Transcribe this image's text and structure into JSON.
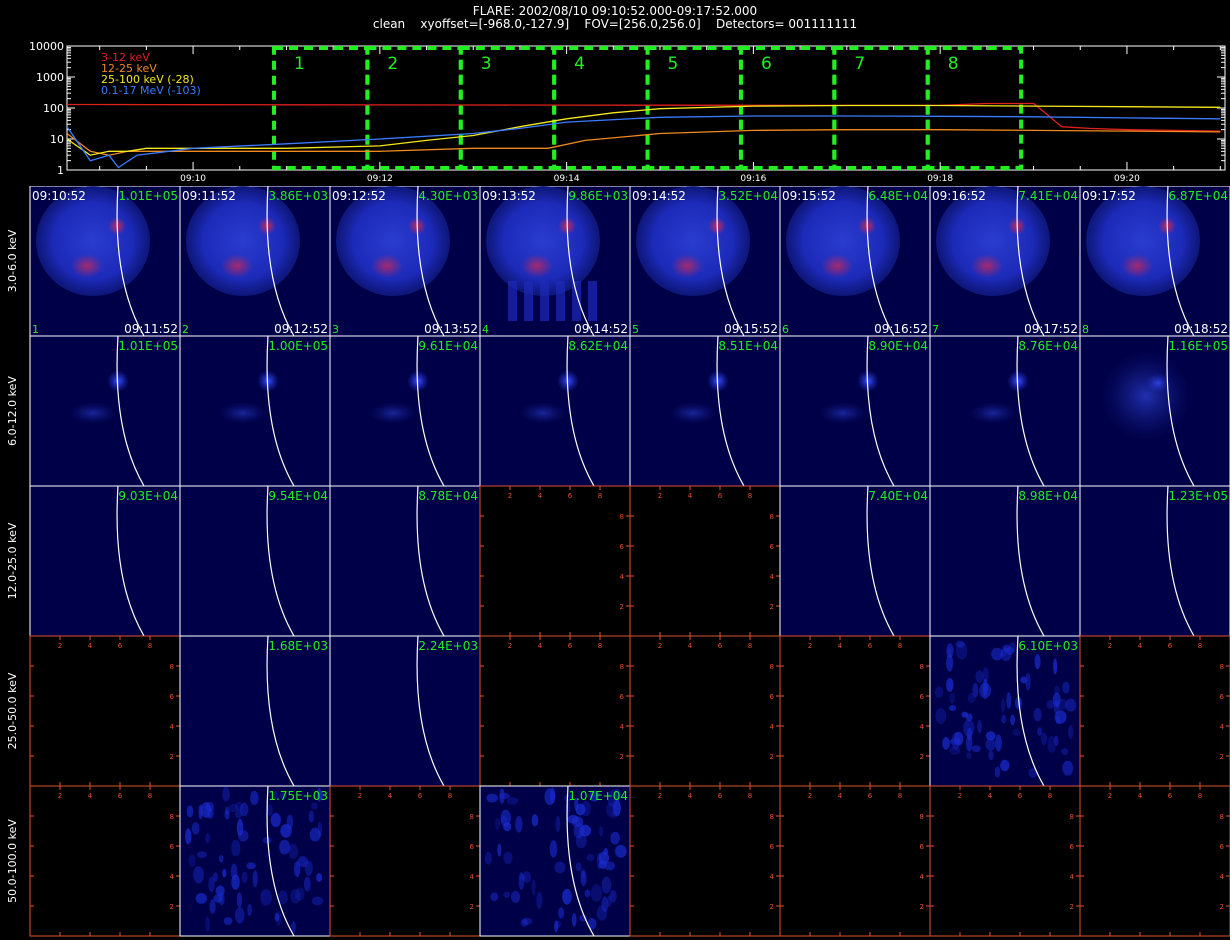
{
  "header": {
    "line1": "FLARE: 2002/08/10 09:10:52.000-09:17:52.000",
    "line2": "clean    xyoffset=[-968.0,-127.9]    FOV=[256.0,256.0]    Detectors= 001111111"
  },
  "chart_data": [
    {
      "type": "line",
      "yscale": "log",
      "ylim": [
        1,
        10000
      ],
      "y_ticks": [
        "10000",
        "1000",
        "100",
        "10",
        "1"
      ],
      "x_ticks": [
        "09:10",
        "09:12",
        "09:14",
        "09:16",
        "09:18",
        "09:20"
      ],
      "x_minutes": [
        10,
        12,
        14,
        16,
        18,
        20
      ],
      "xlim_minutes": [
        8.65,
        21.05
      ],
      "grid": false,
      "legend_position": "top-left",
      "series": [
        {
          "name": "3-12 keV",
          "color": "#e0201c",
          "x": [
            8.65,
            9.0,
            9.5,
            10.0,
            11.0,
            12.0,
            13.0,
            14.0,
            15.0,
            16.0,
            17.0,
            18.0,
            18.5,
            19.0,
            19.1,
            19.3,
            19.6,
            20.0,
            20.5,
            21.0
          ],
          "y": [
            130,
            130,
            129,
            128,
            127,
            126,
            125,
            124,
            123,
            122,
            121,
            121,
            140,
            140,
            80,
            25,
            22,
            20,
            19,
            18
          ]
        },
        {
          "name": "12-25 keV",
          "color": "#f08a1e",
          "x": [
            8.65,
            8.9,
            9.1,
            9.3,
            9.5,
            10.0,
            11.0,
            12.0,
            13.0,
            13.8,
            14.2,
            15.0,
            16.0,
            17.0,
            18.0,
            19.0,
            20.0,
            21.0
          ],
          "y": [
            15,
            4,
            3,
            4,
            4,
            4,
            4,
            4,
            5,
            5,
            9,
            15,
            19,
            20,
            20,
            19,
            18,
            17
          ]
        },
        {
          "name": "25-100 keV (-28)",
          "color": "#f4e81e",
          "x": [
            8.65,
            8.9,
            9.1,
            9.3,
            9.5,
            10.0,
            11.0,
            12.0,
            12.5,
            13.0,
            13.5,
            14.0,
            14.5,
            15.0,
            16.0,
            17.0,
            18.0,
            19.0,
            20.0,
            21.0
          ],
          "y": [
            10,
            3,
            4,
            4,
            5,
            5,
            5,
            6,
            9,
            13,
            25,
            45,
            70,
            95,
            115,
            120,
            120,
            115,
            110,
            105
          ]
        },
        {
          "name": "0.1-17 MeV (-103)",
          "color": "#3b7bff",
          "x": [
            8.65,
            8.9,
            9.1,
            9.2,
            9.4,
            10.0,
            11.0,
            12.0,
            13.0,
            13.5,
            14.0,
            15.0,
            16.0,
            17.0,
            18.0,
            19.0,
            20.0,
            21.0
          ],
          "y": [
            25,
            2,
            3,
            1.2,
            3,
            5,
            7,
            10,
            15,
            22,
            35,
            50,
            55,
            55,
            54,
            52,
            48,
            45
          ]
        }
      ],
      "intervals": [
        "1",
        "2",
        "3",
        "4",
        "5",
        "6",
        "7",
        "8"
      ],
      "interval_color": "#22ee22"
    },
    {
      "type": "heatmap",
      "rows": [
        "3.0-6.0 keV",
        "6.0-12.0 keV",
        "12.0-25.0 keV",
        "25.0-50.0 keV",
        "50.0-100.0 keV"
      ],
      "row_color": "#ffffff",
      "time_color": "#ffffff",
      "peak_color": "#22ee22",
      "axis_color": "#e05030",
      "axis_tick_labels": [
        "2",
        "4",
        "6",
        "8"
      ],
      "panels": [
        [
          {
            "start": "09:10:52",
            "end": "09:11:52",
            "peak": "1.01E+05",
            "index": "1",
            "kind": "disk"
          },
          {
            "start": "09:11:52",
            "end": "09:12:52",
            "peak": "3.86E+03",
            "index": "2",
            "kind": "disk"
          },
          {
            "start": "09:12:52",
            "end": "09:13:52",
            "peak": "4.30E+03",
            "index": "3",
            "kind": "disk"
          },
          {
            "start": "09:13:52",
            "end": "09:14:52",
            "peak": "9.86E+03",
            "index": "4",
            "kind": "disk"
          },
          {
            "start": "09:14:52",
            "end": "09:15:52",
            "peak": "3.52E+04",
            "index": "5",
            "kind": "disk"
          },
          {
            "start": "09:15:52",
            "end": "09:16:52",
            "peak": "6.48E+04",
            "index": "6",
            "kind": "disk"
          },
          {
            "start": "09:16:52",
            "end": "09:17:52",
            "peak": "7.41E+04",
            "index": "7",
            "kind": "disk"
          },
          {
            "start": "09:17:52",
            "end": "09:18:52",
            "peak": "6.87E+04",
            "index": "8",
            "kind": "disk"
          }
        ],
        [
          {
            "peak": "1.01E+05",
            "kind": "spot"
          },
          {
            "peak": "1.00E+05",
            "kind": "spot"
          },
          {
            "peak": "9.61E+04",
            "kind": "spot"
          },
          {
            "peak": "8.62E+04",
            "kind": "spot"
          },
          {
            "peak": "8.51E+04",
            "kind": "spot"
          },
          {
            "peak": "8.90E+04",
            "kind": "spot"
          },
          {
            "peak": "8.76E+04",
            "kind": "spot"
          },
          {
            "peak": "1.16E+05",
            "kind": "diffuse"
          }
        ],
        [
          {
            "peak": "9.03E+04",
            "kind": "dim"
          },
          {
            "peak": "9.54E+04",
            "kind": "dim"
          },
          {
            "peak": "8.78E+04",
            "kind": "dim"
          },
          {
            "peak": "",
            "kind": "empty"
          },
          {
            "peak": "",
            "kind": "empty"
          },
          {
            "peak": "7.40E+04",
            "kind": "dim"
          },
          {
            "peak": "8.98E+04",
            "kind": "dim"
          },
          {
            "peak": "1.23E+05",
            "kind": "dim"
          }
        ],
        [
          {
            "peak": "",
            "kind": "empty"
          },
          {
            "peak": "1.68E+03",
            "kind": "dim"
          },
          {
            "peak": "2.24E+03",
            "kind": "dim"
          },
          {
            "peak": "",
            "kind": "empty"
          },
          {
            "peak": "",
            "kind": "empty"
          },
          {
            "peak": "",
            "kind": "empty"
          },
          {
            "peak": "6.10E+03",
            "kind": "noisy"
          },
          {
            "peak": "",
            "kind": "empty"
          }
        ],
        [
          {
            "peak": "",
            "kind": "empty"
          },
          {
            "peak": "1.75E+03",
            "kind": "noisy"
          },
          {
            "peak": "",
            "kind": "empty"
          },
          {
            "peak": "1.07E+04",
            "kind": "noisy"
          },
          {
            "peak": "",
            "kind": "empty"
          },
          {
            "peak": "",
            "kind": "empty"
          },
          {
            "peak": "",
            "kind": "empty"
          },
          {
            "peak": "",
            "kind": "empty"
          }
        ]
      ]
    }
  ]
}
